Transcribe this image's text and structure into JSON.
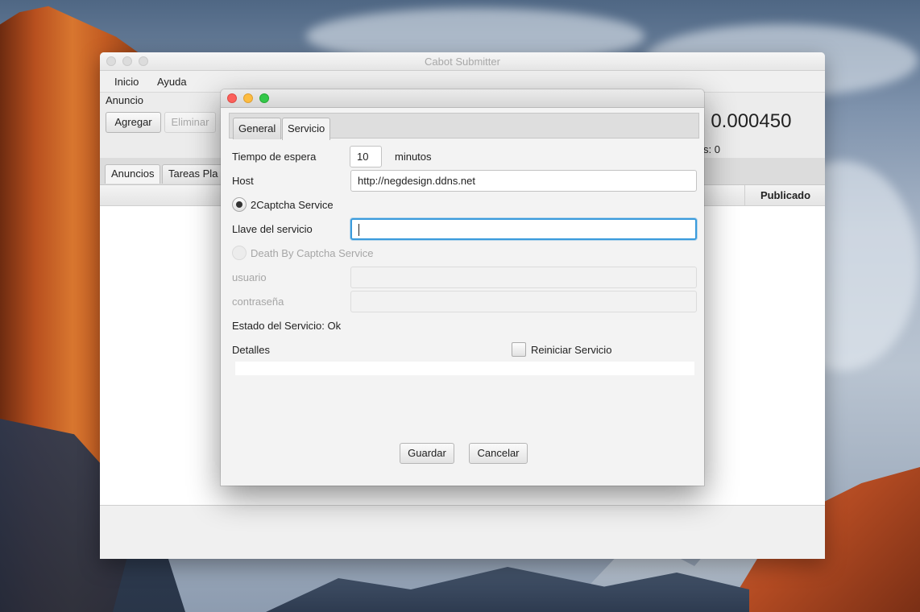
{
  "main_window": {
    "title": "Cabot Submitter",
    "menu": [
      "Inicio",
      "Ayuda"
    ],
    "section_label": "Anuncio",
    "add_button": "Agregar",
    "delete_button": "Eliminar",
    "balance_value_partial": ": 0.000450",
    "secondary_value_partial": "s:  0",
    "tabs": [
      "Anuncios",
      "Tareas Pla"
    ],
    "table": {
      "columns": [
        "Publicado"
      ]
    }
  },
  "dialog": {
    "tabs": [
      "General",
      "Servicio"
    ],
    "selected_tab": "Servicio",
    "timeout_label": "Tiempo de espera",
    "timeout_value": "10",
    "timeout_unit": "minutos",
    "host_label": "Host",
    "host_value": "http://negdesign.ddns.net",
    "option_2captcha": "2Captcha Service",
    "option_2captcha_selected": true,
    "service_key_label": "Llave del servicio",
    "service_key_value": "",
    "option_deathbycaptcha": "Death By Captcha Service",
    "option_deathbycaptcha_selected": false,
    "user_label": "usuario",
    "user_value": "",
    "password_label": "contraseña",
    "password_value": "",
    "status_text": "Estado del Servicio: Ok",
    "details_label": "Detalles",
    "restart_label": "Reiniciar Servicio",
    "restart_checked": false,
    "save_button": "Guardar",
    "cancel_button": "Cancelar"
  },
  "colors": {
    "focus_ring": "#3a9bdc",
    "close": "#fc605b",
    "minimize": "#fdbc40",
    "maximize": "#34c84a"
  }
}
